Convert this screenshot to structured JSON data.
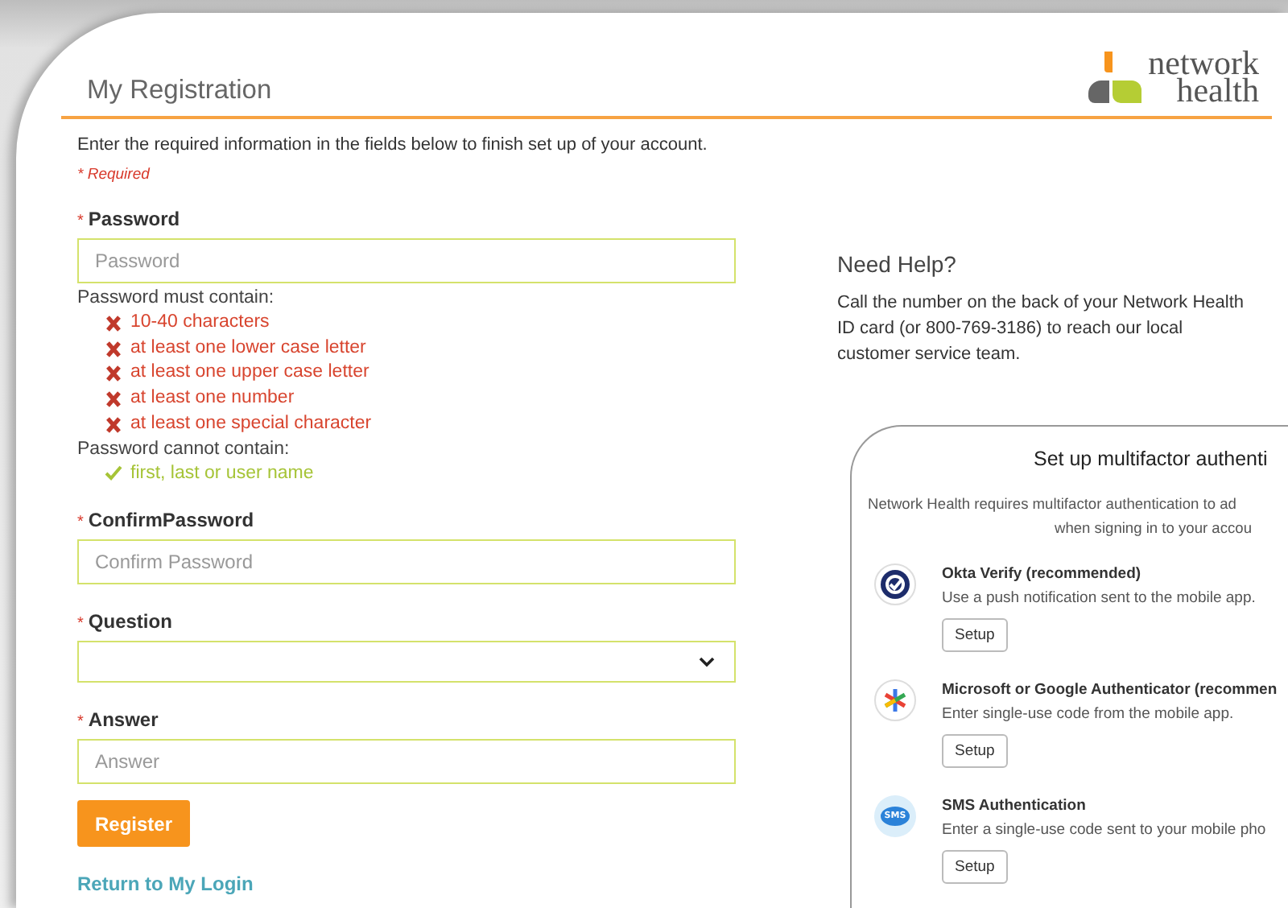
{
  "header": {
    "title": "My Registration",
    "logo": [
      "network",
      "health"
    ]
  },
  "intro": "Enter the required information in the fields below to finish set up of your account.",
  "required_note": "* Required",
  "fields": [
    {
      "kind": "text",
      "mark": "*",
      "label": "Password",
      "placeholder": "Password"
    },
    {
      "kind": "text",
      "mark": "*",
      "label": "ConfirmPassword",
      "placeholder": "Confirm Password"
    },
    {
      "kind": "select",
      "mark": "*",
      "label": "Question"
    },
    {
      "kind": "text",
      "mark": "*",
      "label": "Answer",
      "placeholder": "Answer"
    }
  ],
  "rules": [
    {
      "heading": "Password must contain:",
      "items": [
        {
          "text": "10-40 characters",
          "met": false
        },
        {
          "text": "at least one lower case letter",
          "met": false
        },
        {
          "text": "at least one upper case letter",
          "met": false
        },
        {
          "text": "at least one number",
          "met": false
        },
        {
          "text": "at least one special character",
          "met": false
        }
      ]
    },
    {
      "heading": "Password cannot contain:",
      "items": [
        {
          "text": "first, last or user name",
          "met": true
        }
      ]
    }
  ],
  "submit": "Register",
  "return_link": "Return to My Login",
  "help": {
    "title": "Need Help?",
    "text": "Call the number on the back of your Network Health ID card (or 800-769-3186) to reach our local customer service team."
  },
  "mfa": {
    "title": "Set up multifactor authenti",
    "description": [
      "Network Health requires multifactor authentication to ad",
      "when signing in to your accou"
    ],
    "methods": [
      {
        "kind": "push",
        "name": "Okta Verify (recommended)",
        "description": "Use a push notification sent to the mobile app.",
        "button": "Setup"
      },
      {
        "kind": "code",
        "name": "Microsoft or Google Authenticator (recommen",
        "description": "Enter single-use code from the mobile app.",
        "button": "Setup"
      },
      {
        "kind": "sms",
        "icon_text": "SMS",
        "name": "SMS Authentication",
        "description": "Enter a single-use code sent to your mobile pho",
        "button": "Setup"
      }
    ]
  }
}
